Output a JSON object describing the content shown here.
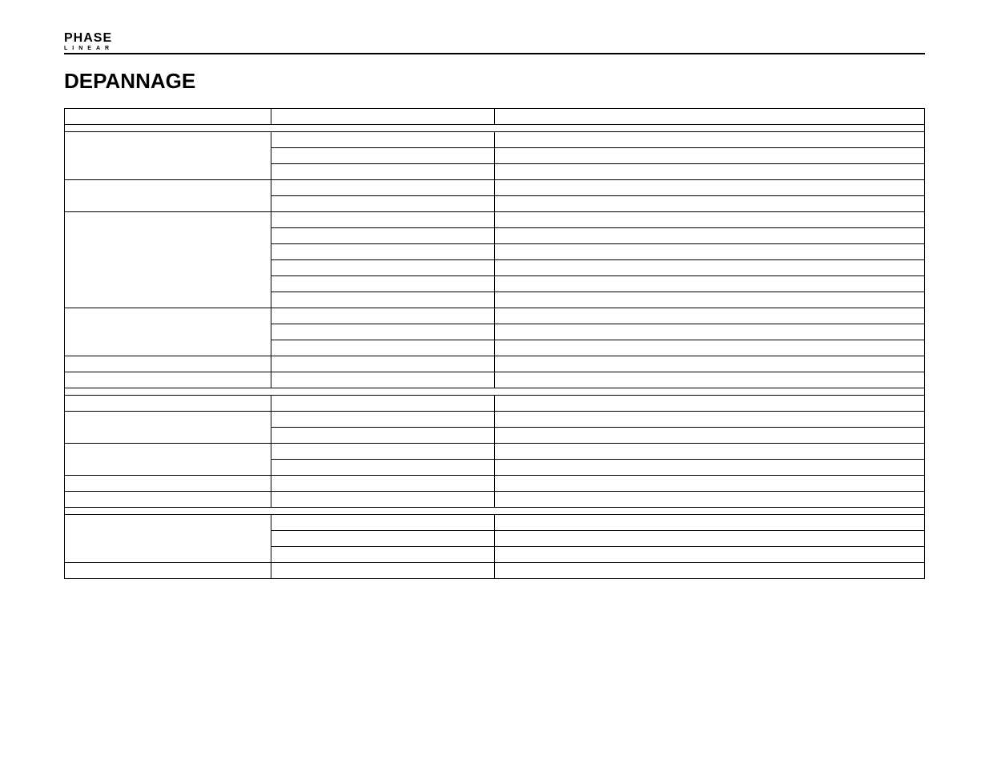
{
  "logo": {
    "top": "PHASE",
    "bottom": "LINEAR"
  },
  "section_title": "DEPANNAGE",
  "table": {
    "headers": [
      "",
      "",
      ""
    ],
    "groups": [
      {
        "type": "separator"
      },
      {
        "col_a": "",
        "rows": [
          [
            "",
            ""
          ],
          [
            "",
            ""
          ],
          [
            "",
            ""
          ]
        ]
      },
      {
        "col_a": "",
        "rows": [
          [
            "",
            ""
          ],
          [
            "",
            ""
          ]
        ]
      },
      {
        "col_a": "",
        "rows": [
          [
            "",
            ""
          ],
          [
            "",
            ""
          ],
          [
            "",
            ""
          ],
          [
            "",
            ""
          ],
          [
            "",
            ""
          ],
          [
            "",
            ""
          ]
        ]
      },
      {
        "col_a": "",
        "rows": [
          [
            "",
            ""
          ],
          [
            "",
            ""
          ],
          [
            "",
            ""
          ]
        ]
      },
      {
        "col_a": "",
        "rows": [
          [
            "",
            ""
          ]
        ]
      },
      {
        "col_a": "",
        "rows": [
          [
            "",
            ""
          ]
        ]
      },
      {
        "type": "separator"
      },
      {
        "col_a": "",
        "rows": [
          [
            "",
            ""
          ]
        ]
      },
      {
        "col_a": "",
        "rows": [
          [
            "",
            ""
          ],
          [
            "",
            ""
          ]
        ],
        "tall": [
          false,
          true
        ]
      },
      {
        "col_a": "",
        "rows": [
          [
            "",
            ""
          ],
          [
            "",
            ""
          ]
        ],
        "tall": [
          true,
          false
        ]
      },
      {
        "col_a": "",
        "rows": [
          [
            "",
            ""
          ]
        ],
        "tall": [
          true
        ]
      },
      {
        "col_a": "",
        "rows": [
          [
            "",
            ""
          ]
        ]
      },
      {
        "type": "separator"
      },
      {
        "col_a": "",
        "rows": [
          [
            "",
            ""
          ],
          [
            "",
            ""
          ],
          [
            "",
            ""
          ]
        ]
      },
      {
        "col_a": "",
        "rows": [
          [
            "",
            ""
          ]
        ]
      }
    ]
  }
}
